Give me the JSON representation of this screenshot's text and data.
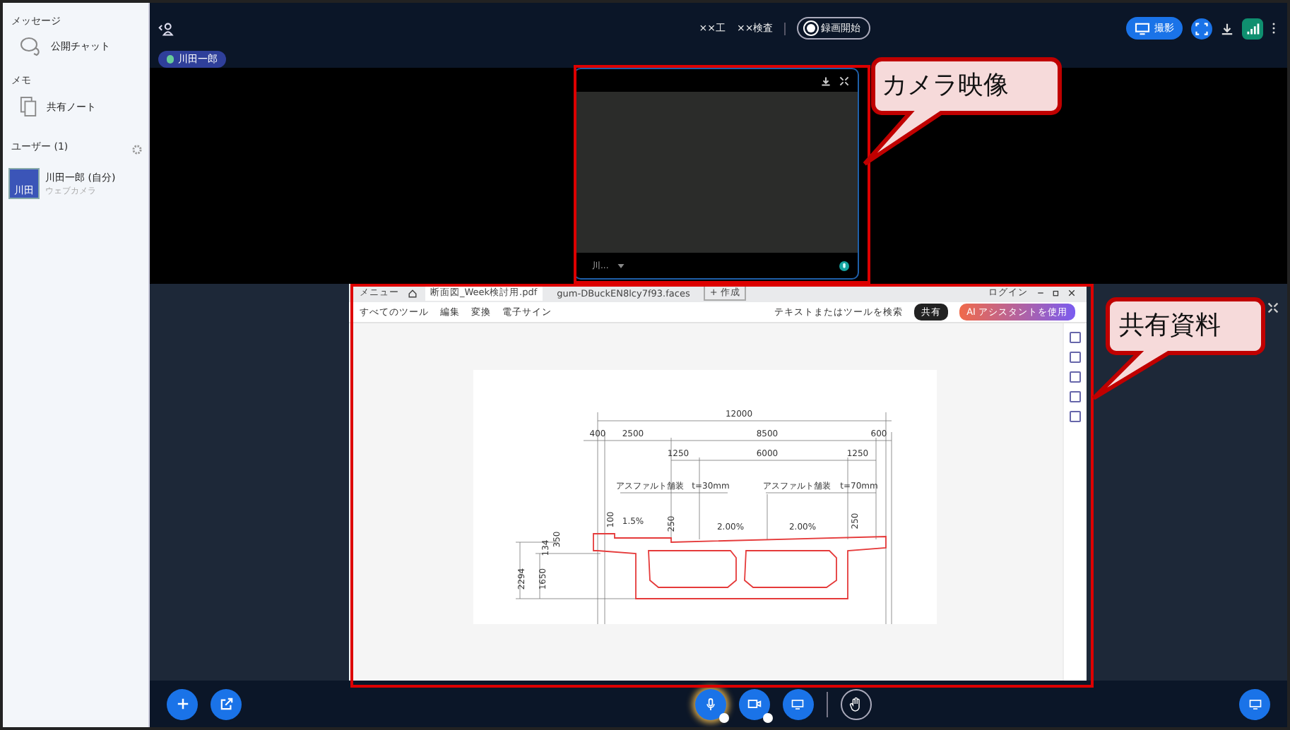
{
  "sidebar": {
    "sections": [
      {
        "heading": "メッセージ",
        "items": [
          {
            "label": "公開チャット",
            "kind": "chat"
          }
        ]
      },
      {
        "heading": "メモ",
        "items": [
          {
            "label": "共有ノート",
            "kind": "note"
          }
        ]
      }
    ],
    "users": {
      "heading": "ユーザー (1)",
      "list": [
        {
          "name": "川田一郎 (自分)",
          "status": "ウェブカメラ",
          "avatar": "川田"
        }
      ]
    }
  },
  "topbar": {
    "user_chip": "川田一郎",
    "labels": [
      "××工",
      "××検査"
    ],
    "record_button": "録画開始",
    "share_button": "撮影"
  },
  "camera_tile": {
    "name": "川..."
  },
  "shared_screen": {
    "menu_button": "メニュー",
    "tabs": [
      {
        "label": "断面図_Week検討用.pdf",
        "selected": true
      },
      {
        "label": "gum-DBuckEN8lcy7f93.faces",
        "selected": false
      }
    ],
    "new_tab_button": "+ 作成",
    "login": "ログイン",
    "toolbar": [
      "すべてのツール",
      "編集",
      "変換",
      "電子サイン"
    ],
    "search": "テキストまたはツールを検索",
    "share_button": "共有",
    "ai_button": "AI アシスタントを使用",
    "drawing_labels": [
      "12000",
      "400",
      "2500",
      "8500",
      "600",
      "1250",
      "6000",
      "1250",
      "アスファルト舗装",
      "t=30mm",
      "アスファルト舗装",
      "t=70mm",
      "1.5%",
      "2.00%",
      "2.00%",
      "100",
      "250",
      "250",
      "2294",
      "1650",
      "134",
      "350"
    ]
  },
  "callouts": [
    "カメラ映像",
    "共有資料"
  ]
}
